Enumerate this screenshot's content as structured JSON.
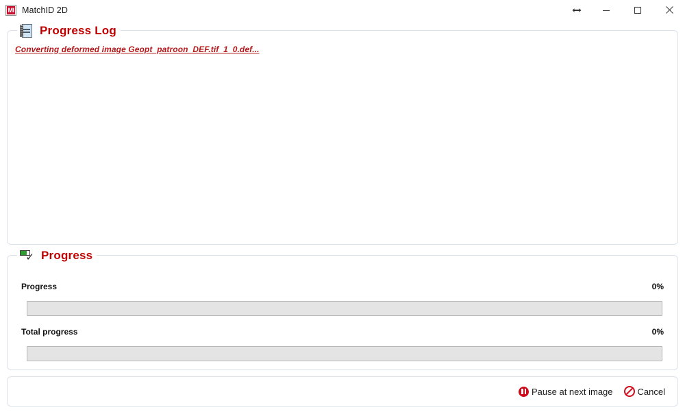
{
  "window": {
    "title": "MatchID 2D",
    "app_icon": "matchid-logo-icon",
    "icon_text": "MI",
    "controls": {
      "resize": "↔",
      "minimize": "—",
      "maximize": "□",
      "close": "✕"
    }
  },
  "progress_log": {
    "title": "Progress Log",
    "icon": "notepad-icon",
    "lines": [
      "Converting deformed image Geopt_patroon_DEF.tif_1_0.def..."
    ]
  },
  "progress": {
    "title": "Progress",
    "icon": "progress-check-icon",
    "rows": [
      {
        "label": "Progress",
        "percent_label": "0%",
        "percent_value": 0
      },
      {
        "label": "Total progress",
        "percent_label": "0%",
        "percent_value": 0
      }
    ]
  },
  "footer": {
    "pause_label": "Pause at next image",
    "pause_icon": "pause-icon",
    "cancel_label": "Cancel",
    "cancel_icon": "cancel-icon"
  },
  "colors": {
    "accent_red": "#c00000",
    "log_text": "#b51a1a",
    "panel_border": "#dbe2ea",
    "bar_track": "#e4e4e4",
    "bar_fill": "#06b025",
    "button_icon_red": "#cf0a1a"
  }
}
